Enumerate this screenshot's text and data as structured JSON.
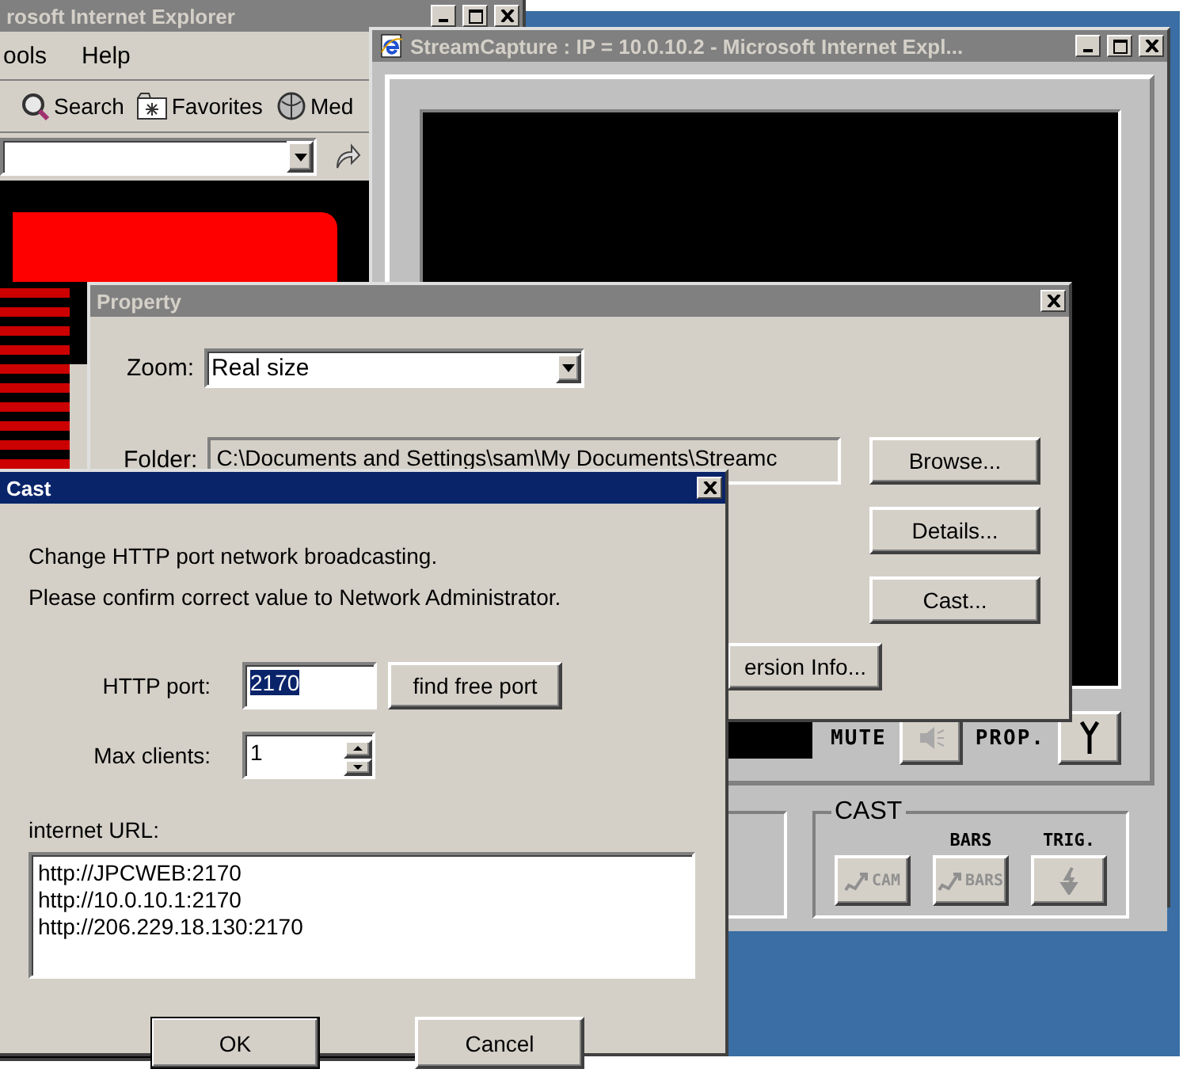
{
  "browser_window": {
    "title": "rosoft Internet Explorer",
    "active": false,
    "menu": [
      "ools",
      "Help"
    ],
    "toolbar": [
      {
        "kind": "search",
        "label": "Search"
      },
      {
        "kind": "favorites",
        "label": "Favorites"
      },
      {
        "kind": "media",
        "label": "Med"
      }
    ]
  },
  "streamcapture_window": {
    "title": "StreamCapture : IP = 10.0.10.2 - Microsoft Internet Expl...",
    "active": false,
    "controls": [
      {
        "kind": "mute",
        "label": "MUTE"
      },
      {
        "kind": "prop",
        "label": "PROP."
      }
    ],
    "cast_group": {
      "title": "CAST",
      "buttons": [
        {
          "kind": "cam",
          "text": "CAM",
          "disabled": true
        },
        {
          "kind": "bars",
          "caption": "BARS",
          "text": "BARS",
          "disabled": true
        },
        {
          "kind": "trig",
          "caption": "TRIG.",
          "disabled": true
        }
      ]
    }
  },
  "property_dialog": {
    "title": "Property",
    "active": false,
    "zoom": {
      "label": "Zoom:",
      "value": "Real size"
    },
    "folder": {
      "label": "Folder:",
      "value": "C:\\Documents and Settings\\sam\\My Documents\\Streamc"
    },
    "buttons": [
      "Browse...",
      "Details...",
      "Cast..."
    ],
    "version_button": "ersion Info..."
  },
  "cast_dialog": {
    "title": "Cast",
    "active": true,
    "messages": [
      "Change HTTP port network broadcasting.",
      "Please confirm correct value to Network Administrator."
    ],
    "http_port": {
      "label": "HTTP port:",
      "value": "2170",
      "highlighted": true
    },
    "find_button": "find free port",
    "max_clients": {
      "label": "Max clients:",
      "value": "1"
    },
    "url_label": "internet URL:",
    "urls": [
      "http://JPCWEB:2170",
      "http://10.0.10.1:2170",
      "http://206.229.18.130:2170"
    ],
    "buttons": [
      "OK",
      "Cancel"
    ]
  }
}
